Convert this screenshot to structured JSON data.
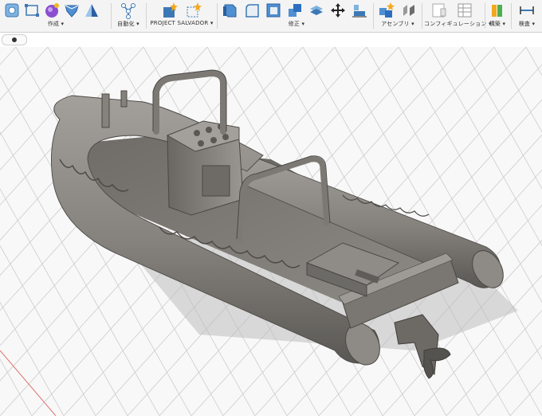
{
  "toolbar": {
    "groups": [
      {
        "label": "作成 ▾"
      },
      {
        "label": "自動化 ▾"
      },
      {
        "label": "PROJECT SALVADOR ▾"
      },
      {
        "label": "修正 ▾"
      },
      {
        "label": "アセンブリ ▾"
      },
      {
        "label": "コンフィギュレーション ▾"
      },
      {
        "label": "構築 ▾"
      },
      {
        "label": "検査 ▾"
      }
    ]
  },
  "icons": {
    "create": [
      "new-component-icon",
      "sketch-icon",
      "form-icon",
      "extrude-icon",
      "revolve-icon"
    ],
    "automate": [
      "automate-graph-icon"
    ],
    "salvador": [
      "salvador-star-icon",
      "salvador-sketch-icon"
    ],
    "modify": [
      "press-pull-icon",
      "fillet-icon",
      "shell-icon",
      "combine-icon",
      "split-icon",
      "move-icon",
      "align-icon"
    ],
    "assemble": [
      "new-component-star-icon",
      "joint-icon"
    ],
    "configure": [
      "configure-icon",
      "config-table-icon"
    ],
    "build": [
      "build-icon"
    ],
    "inspect": [
      "measure-icon"
    ]
  },
  "viewport": {
    "model": "rigid-inflatable-boat",
    "colors": {
      "hull": "#85827d",
      "hull_dark": "#55534f",
      "tube": "#8c8984",
      "grid": "#c9c9c9",
      "background": "#f8f8f8",
      "axis": "#e07070"
    }
  }
}
